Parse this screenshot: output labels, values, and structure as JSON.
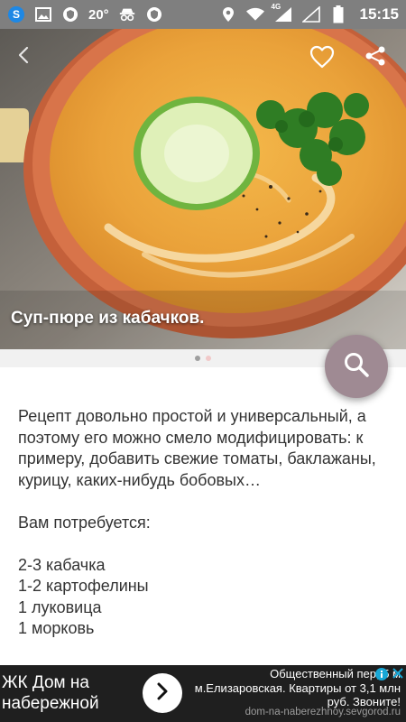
{
  "status_bar": {
    "temperature": "20°",
    "network_label": "4G",
    "time": "15:15",
    "icons": [
      "app-s-icon",
      "image-icon",
      "shield-icon",
      "incognito-icon",
      "shield-icon",
      "location-icon",
      "wifi-icon",
      "signal-icon",
      "signal-empty-icon",
      "battery-icon"
    ]
  },
  "hero": {
    "title": "Суп-пюре из кабачков.",
    "buttons": [
      "back-arrow-icon",
      "heart-icon",
      "share-icon"
    ]
  },
  "carousel": {
    "page_count": 2,
    "active_index": 0
  },
  "fab": {
    "icon": "search-icon",
    "color": "#9f8a93"
  },
  "content": {
    "intro": "Рецепт довольно простой и универсальный, а поэтому его можно смело модифицировать: к примеру, добавить свежие томаты, баклажаны, курицу, каких-нибудь бобовых…",
    "needs_label": "Вам потребуется:",
    "ingredients": [
      "2-3 кабачка",
      "1-2 картофелины",
      "1 луковица",
      "1 морковь"
    ]
  },
  "ad": {
    "headline": "ЖК Дом на набережной",
    "description": "Общественный пер, 5 м м.Елизаровская. Квартиры от 3,1 млн руб. Звоните!",
    "url": "dom-na-naberezhnoy.sevgorod.ru",
    "arrow_icon": "chevron-right-icon",
    "info_icon": "info-icon",
    "close_icon": "close-icon"
  }
}
